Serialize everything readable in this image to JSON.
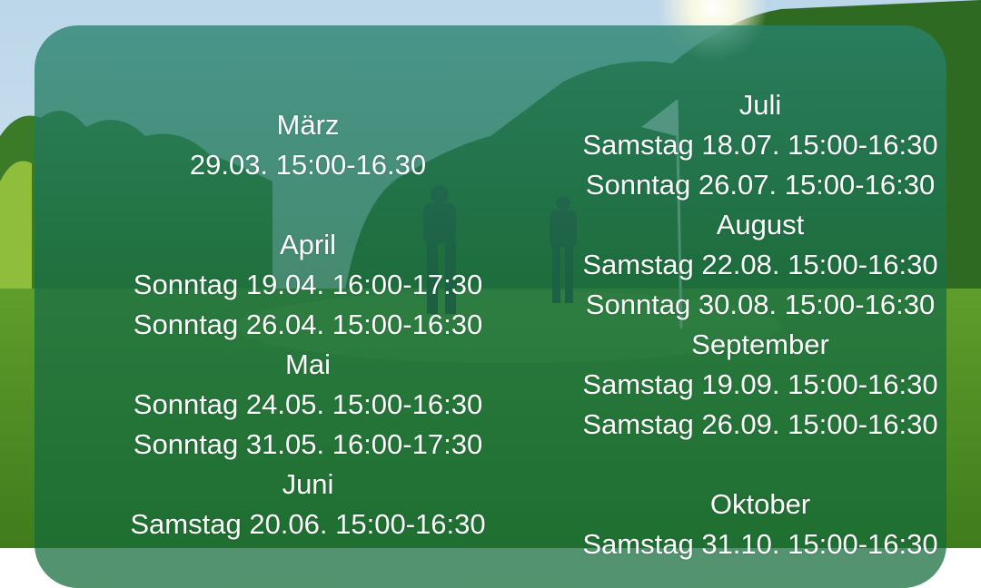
{
  "schedule": {
    "left": [
      {
        "month": "März",
        "dates": [
          "29.03. 15:00-16.30"
        ]
      },
      {
        "month": "April",
        "dates": [
          "Sonntag 19.04. 16:00-17:30",
          "Sonntag 26.04. 15:00-16:30"
        ]
      },
      {
        "month": "Mai",
        "dates": [
          "Sonntag 24.05. 15:00-16:30",
          "Sonntag 31.05. 16:00-17:30"
        ]
      },
      {
        "month": "Juni",
        "dates": [
          "Samstag 20.06. 15:00-16:30"
        ]
      }
    ],
    "right": [
      {
        "month": "Juli",
        "dates": [
          "Samstag 18.07. 15:00-16:30",
          "Sonntag 26.07. 15:00-16:30"
        ]
      },
      {
        "month": "August",
        "dates": [
          "Samstag 22.08. 15:00-16:30",
          "Sonntag 30.08. 15:00-16:30"
        ]
      },
      {
        "month": "September",
        "dates": [
          "Samstag 19.09. 15:00-16:30",
          "Samstag 26.09. 15:00-16:30"
        ]
      },
      {
        "month": "Oktober",
        "dates": [
          "Samstag 31.10. 15:00-16:30"
        ]
      }
    ]
  }
}
